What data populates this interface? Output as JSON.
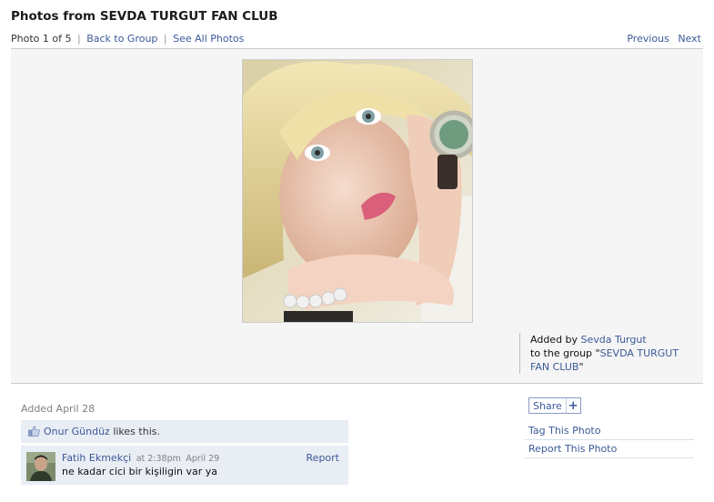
{
  "header": {
    "title": "Photos from SEVDA TURGUT FAN CLUB"
  },
  "subnav": {
    "position_text": "Photo 1 of 5",
    "back_link": "Back to Group",
    "see_all_link": "See All Photos",
    "separator": "|"
  },
  "pager": {
    "previous": "Previous",
    "next": "Next"
  },
  "photo_info": {
    "added_by_prefix": "Added by",
    "author": "Sevda Turgut",
    "group_prefix": "to the group ",
    "group_name": "SEVDA TURGUT FAN CLUB",
    "quote": "\""
  },
  "added_date": "Added April 28",
  "likes": {
    "user": "Onur Gündüz",
    "suffix": " likes this."
  },
  "comment": {
    "author": "Fatih Ekmekçi",
    "time": "at 2:38pm",
    "date": "April 29",
    "text": "ne kadar cici bir kişiligin var ya",
    "report": "Report"
  },
  "sidebar": {
    "share_label": "Share",
    "share_plus": "+",
    "tag_link": "Tag This Photo",
    "report_link": "Report This Photo"
  },
  "colors": {
    "link": "#3b5998",
    "panel_bg": "#e9edf4",
    "stage_bg": "#f5f5f5"
  },
  "icons": {
    "like": "thumbs-up-icon",
    "share_plus": "plus-icon"
  }
}
